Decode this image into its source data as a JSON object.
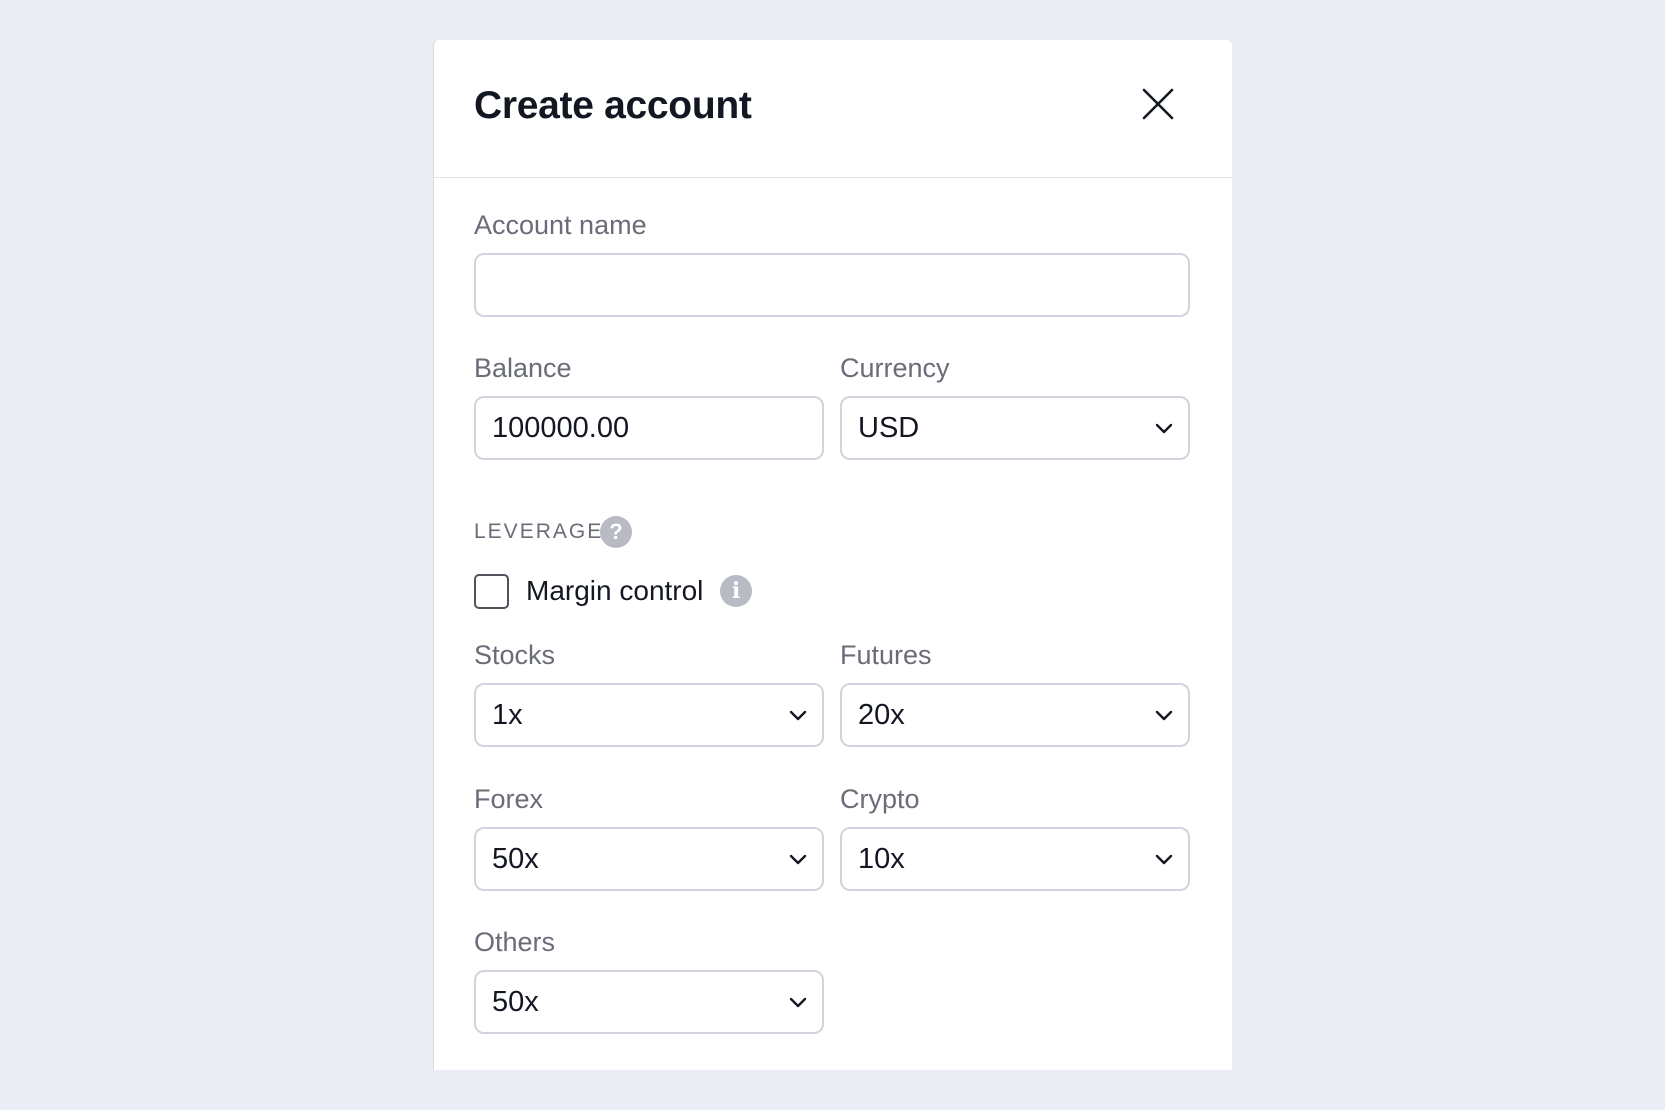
{
  "dialog": {
    "title": "Create account",
    "close_icon": "close-icon"
  },
  "account_name": {
    "label": "Account name",
    "value": "",
    "placeholder": ""
  },
  "balance": {
    "label": "Balance",
    "value": "100000.00"
  },
  "currency": {
    "label": "Currency",
    "value": "USD"
  },
  "leverage": {
    "section_label": "LEVERAGE",
    "help_icon": "question-circle-icon",
    "help_glyph": "?",
    "margin_control": {
      "label": "Margin control",
      "checked": false,
      "info_icon": "info-circle-icon",
      "info_glyph": "i"
    },
    "stocks": {
      "label": "Stocks",
      "value": "1x"
    },
    "futures": {
      "label": "Futures",
      "value": "20x"
    },
    "forex": {
      "label": "Forex",
      "value": "50x"
    },
    "crypto": {
      "label": "Crypto",
      "value": "10x"
    },
    "others": {
      "label": "Others",
      "value": "50x"
    }
  }
}
